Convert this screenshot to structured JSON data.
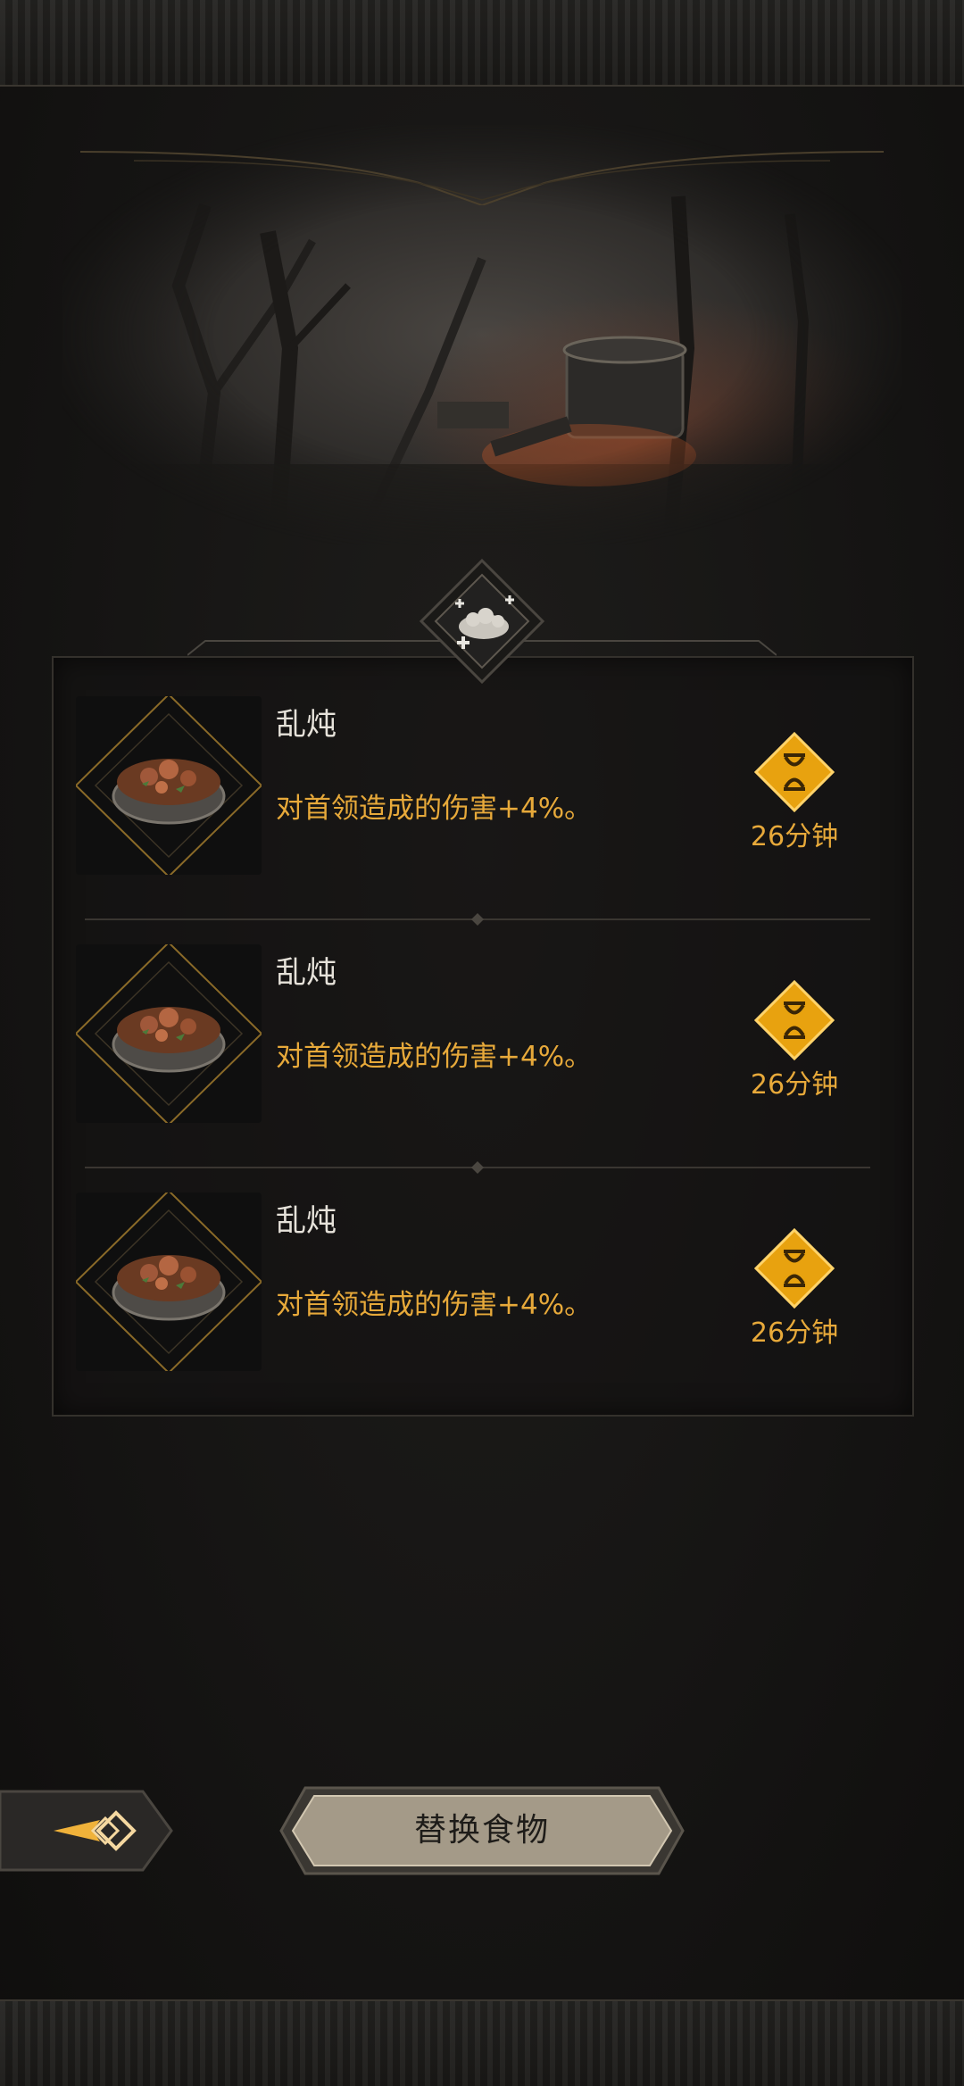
{
  "header": {
    "emblem_icon": "food-emblem-icon"
  },
  "food_list": [
    {
      "name": "乱炖",
      "effect": "对首领造成的伤害+4%。",
      "duration": "26分钟",
      "icon": "stew-bowl-icon"
    },
    {
      "name": "乱炖",
      "effect": "对首领造成的伤害+4%。",
      "duration": "26分钟",
      "icon": "stew-bowl-icon"
    },
    {
      "name": "乱炖",
      "effect": "对首领造成的伤害+4%。",
      "duration": "26分钟",
      "icon": "stew-bowl-icon"
    }
  ],
  "footer": {
    "back_icon": "back-arrow-icon",
    "replace_label": "替换食物"
  },
  "colors": {
    "accent_gold": "#e7a93a",
    "text_light": "#e6e2da",
    "background": "#141312"
  }
}
